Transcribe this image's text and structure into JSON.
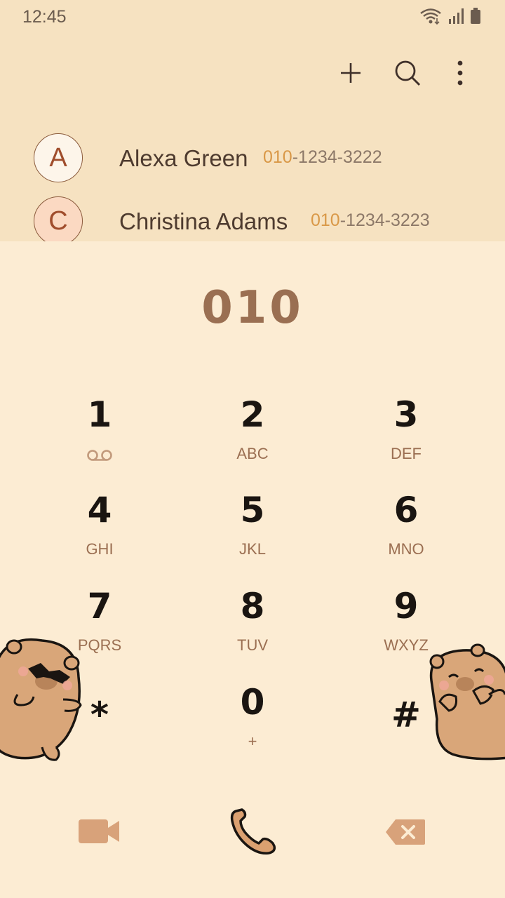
{
  "status": {
    "time": "12:45"
  },
  "toolbar": {
    "add_icon": "plus-icon",
    "search_icon": "search-icon",
    "more_icon": "more-vertical-icon"
  },
  "contacts": [
    {
      "initial": "A",
      "name": "Alexa Green",
      "number_match": "010",
      "number_rest": "-1234-3222"
    },
    {
      "initial": "C",
      "name": "Christina Adams",
      "number_match": "010",
      "number_rest": "-1234-3223"
    }
  ],
  "dialer": {
    "entered_number": "010"
  },
  "keypad": [
    {
      "digit": "1",
      "letters": "",
      "icon": "voicemail-icon"
    },
    {
      "digit": "2",
      "letters": "ABC"
    },
    {
      "digit": "3",
      "letters": "DEF"
    },
    {
      "digit": "4",
      "letters": "GHI"
    },
    {
      "digit": "5",
      "letters": "JKL"
    },
    {
      "digit": "6",
      "letters": "MNO"
    },
    {
      "digit": "7",
      "letters": "PQRS"
    },
    {
      "digit": "8",
      "letters": "TUV"
    },
    {
      "digit": "9",
      "letters": "WXYZ"
    },
    {
      "digit": "*",
      "letters": ""
    },
    {
      "digit": "0",
      "letters": "+"
    },
    {
      "digit": "#",
      "letters": ""
    }
  ],
  "bottom_bar": {
    "video_icon": "video-call-icon",
    "call_icon": "phone-call-icon",
    "delete_icon": "backspace-icon"
  },
  "colors": {
    "header_bg": "#f6e2c1",
    "body_bg": "#fcecd3",
    "accent": "#d99847",
    "brown": "#9a6f52",
    "button_brown": "#d8a27a"
  }
}
